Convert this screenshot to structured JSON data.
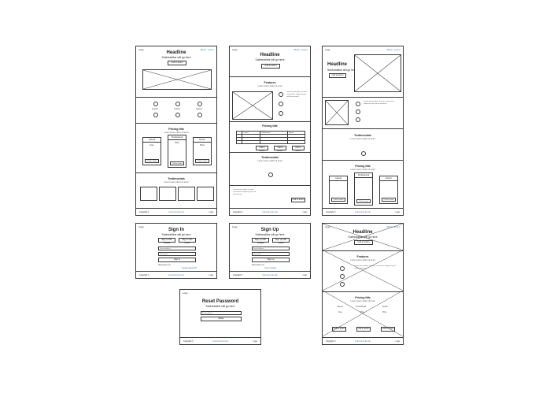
{
  "common": {
    "logo": "Logo",
    "nav": "Menu, Log in",
    "headline": "Headline",
    "subheadline": "Subheadline will go here",
    "cta": "Call to action",
    "small_text": "Lorem ipsum dolor sit amet",
    "feature_text": "Lorem ipsum dolor sit amet, consectetur adipiscing elit sed do eiusmod",
    "icon_label": "Feature",
    "footer_left": "Copyright ©",
    "footer_center": "Link  Link  Link  Link",
    "footer_right": "Logo"
  },
  "pricing": {
    "title": "Pricing title",
    "sub": "Lorem ipsum dolor sit amet",
    "plans": [
      {
        "name": "Casual",
        "price": "Free",
        "features": [
          "Feature",
          "Feature",
          "Feature"
        ],
        "button": "Call to action"
      },
      {
        "name": "Professional",
        "price": "Price",
        "features": [
          "Feature",
          "Feature",
          "Feature"
        ],
        "button": "Call to action"
      },
      {
        "name": "Expert",
        "price": "Price",
        "features": [
          "Feature",
          "Feature",
          "Feature"
        ],
        "button": "Call to action"
      }
    ]
  },
  "testimonials": {
    "title": "Testimonials",
    "sub": "Lorem ipsum dolor sit amet",
    "quote": "Lorem ipsum dolor sit amet, consectetur adipiscing"
  },
  "features": {
    "title": "Features",
    "sub": "Lorem ipsum dolor sit amet"
  },
  "signin": {
    "title": "Sign In",
    "sub": "Subheadline will go here",
    "social1": "Sign in with Google",
    "social2": "Sign in with Twitter",
    "email_placeholder": "Email address",
    "password_placeholder": "Password",
    "submit": "Sign in",
    "remember": "Remember me",
    "forgot": "Forgot password?"
  },
  "signup": {
    "title": "Sign Up",
    "sub": "Subheadline will go here",
    "social1": "Sign up with Google",
    "social2": "Sign up with Twitter",
    "email_placeholder": "Email address",
    "password_placeholder": "Password",
    "submit": "Sign up",
    "remember": "Remember me",
    "login": "Log in instead"
  },
  "reset": {
    "title": "Reset Password",
    "sub": "Subheadline will go here",
    "email_placeholder": "Email address",
    "submit": "Reset"
  }
}
